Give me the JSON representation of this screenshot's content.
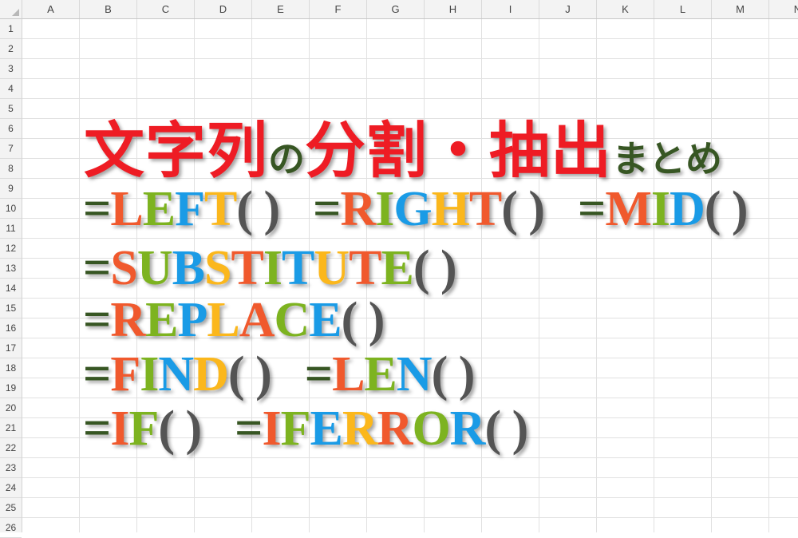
{
  "spreadsheet": {
    "columns": [
      "A",
      "B",
      "C",
      "D",
      "E",
      "F",
      "G",
      "H",
      "I",
      "J",
      "K",
      "L",
      "M",
      "N"
    ],
    "rows": [
      "1",
      "2",
      "3",
      "4",
      "5",
      "6",
      "7",
      "8",
      "9",
      "10",
      "11",
      "12",
      "13",
      "14",
      "15",
      "16",
      "17",
      "18",
      "19",
      "20",
      "21",
      "22",
      "23",
      "24",
      "25",
      "26"
    ]
  },
  "colors": {
    "red": "#ee1c24",
    "dark_green": "#375623",
    "orange": "#f0592d",
    "green": "#7db320",
    "blue": "#1a9be6",
    "yellow": "#fbb71c",
    "gray": "#545454"
  },
  "title": {
    "segments": [
      {
        "text": "文字列",
        "color": "red",
        "size": "big"
      },
      {
        "text": "の",
        "color": "dark_green",
        "size": "small"
      },
      {
        "text": "分割・抽出",
        "color": "red",
        "size": "big"
      },
      {
        "text": "まとめ",
        "color": "dark_green",
        "size": "small"
      }
    ]
  },
  "formulas": [
    {
      "line": 1,
      "items": [
        [
          [
            "=",
            "dark_green"
          ],
          [
            "L",
            "orange"
          ],
          [
            "E",
            "green"
          ],
          [
            "F",
            "blue"
          ],
          [
            "T",
            "yellow"
          ],
          [
            "( )",
            "gray"
          ]
        ],
        [
          [
            "=",
            "dark_green"
          ],
          [
            "R",
            "orange"
          ],
          [
            "I",
            "green"
          ],
          [
            "G",
            "blue"
          ],
          [
            "H",
            "yellow"
          ],
          [
            "T",
            "orange"
          ],
          [
            "( )",
            "gray"
          ]
        ],
        [
          [
            "=",
            "dark_green"
          ],
          [
            "M",
            "orange"
          ],
          [
            "I",
            "green"
          ],
          [
            "D",
            "blue"
          ],
          [
            "( )",
            "gray"
          ]
        ]
      ]
    },
    {
      "line": 2,
      "items": [
        [
          [
            "=",
            "dark_green"
          ],
          [
            "S",
            "orange"
          ],
          [
            "U",
            "green"
          ],
          [
            "B",
            "blue"
          ],
          [
            "S",
            "yellow"
          ],
          [
            "T",
            "orange"
          ],
          [
            "I",
            "green"
          ],
          [
            "T",
            "blue"
          ],
          [
            "U",
            "yellow"
          ],
          [
            "T",
            "orange"
          ],
          [
            "E",
            "green"
          ],
          [
            "( )",
            "gray"
          ]
        ]
      ]
    },
    {
      "line": 3,
      "items": [
        [
          [
            "=",
            "dark_green"
          ],
          [
            "R",
            "orange"
          ],
          [
            "E",
            "green"
          ],
          [
            "P",
            "blue"
          ],
          [
            "L",
            "yellow"
          ],
          [
            "A",
            "orange"
          ],
          [
            "C",
            "green"
          ],
          [
            "E",
            "blue"
          ],
          [
            "( )",
            "gray"
          ]
        ]
      ]
    },
    {
      "line": 4,
      "items": [
        [
          [
            "=",
            "dark_green"
          ],
          [
            "F",
            "orange"
          ],
          [
            "I",
            "green"
          ],
          [
            "N",
            "blue"
          ],
          [
            "D",
            "yellow"
          ],
          [
            "( )",
            "gray"
          ]
        ],
        [
          [
            "=",
            "dark_green"
          ],
          [
            "L",
            "orange"
          ],
          [
            "E",
            "green"
          ],
          [
            "N",
            "blue"
          ],
          [
            "( )",
            "gray"
          ]
        ]
      ]
    },
    {
      "line": 5,
      "items": [
        [
          [
            "=",
            "dark_green"
          ],
          [
            "I",
            "orange"
          ],
          [
            "F",
            "green"
          ],
          [
            "( )",
            "gray"
          ]
        ],
        [
          [
            "=",
            "dark_green"
          ],
          [
            "I",
            "orange"
          ],
          [
            "F",
            "green"
          ],
          [
            "E",
            "blue"
          ],
          [
            "R",
            "yellow"
          ],
          [
            "R",
            "orange"
          ],
          [
            "O",
            "green"
          ],
          [
            "R",
            "blue"
          ],
          [
            "( )",
            "gray"
          ]
        ]
      ]
    }
  ]
}
